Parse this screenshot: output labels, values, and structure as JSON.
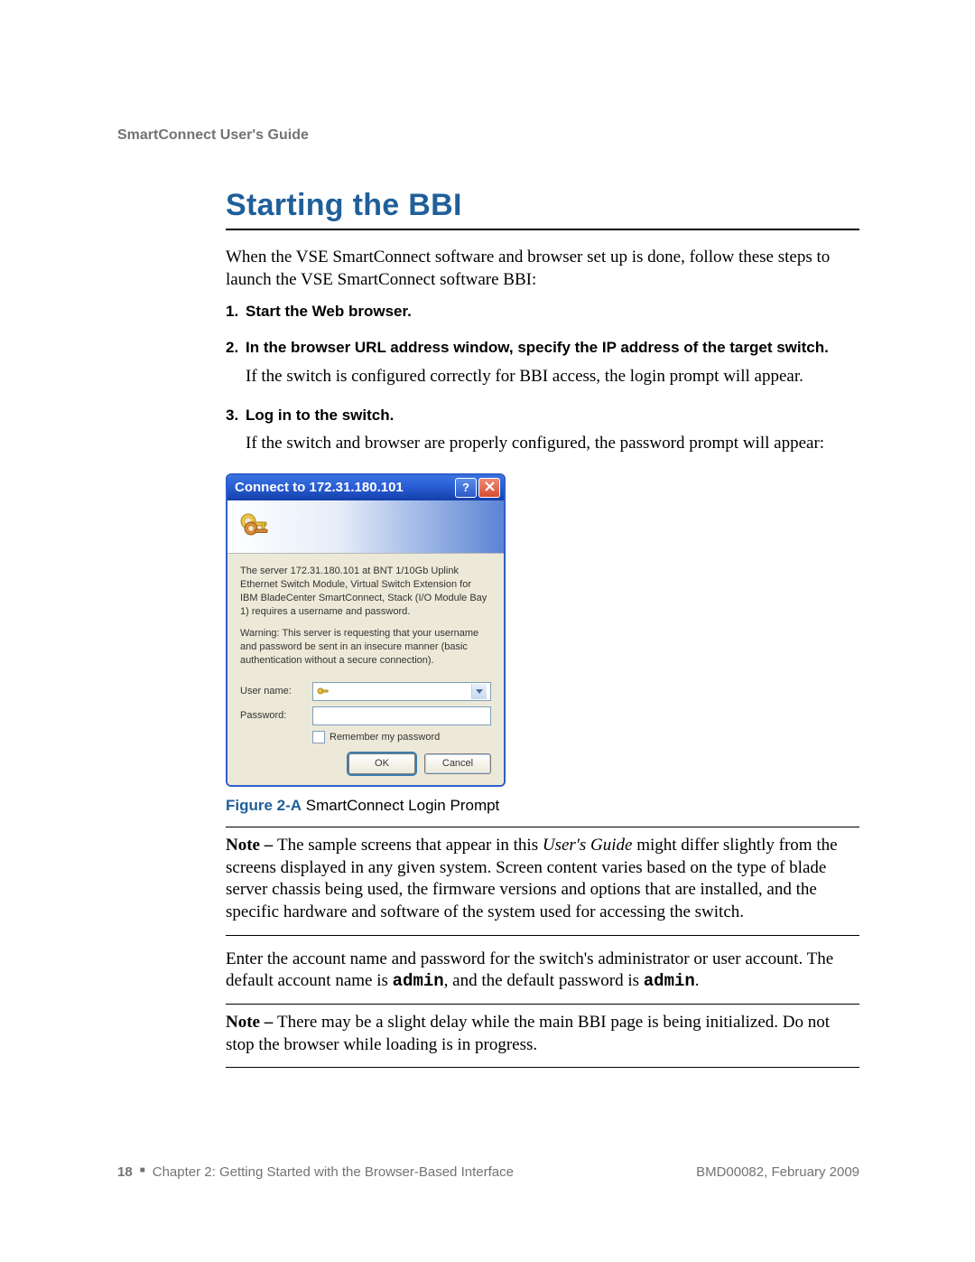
{
  "runningHeader": "SmartConnect User's Guide",
  "sectionTitle": "Starting the BBI",
  "intro": "When the VSE SmartConnect software and browser set up is done, follow these steps to launch the VSE SmartConnect software BBI:",
  "steps": [
    {
      "num": "1.",
      "title": "Start the Web browser."
    },
    {
      "num": "2.",
      "title": "In the browser URL address window, specify the IP address of the target switch.",
      "text": "If the switch is configured correctly for BBI access, the login prompt will appear."
    },
    {
      "num": "3.",
      "title": "Log in to the switch.",
      "text": "If the switch and browser are properly configured, the password prompt will appear:"
    }
  ],
  "dialog": {
    "title": "Connect to 172.31.180.101",
    "helpGlyph": "?",
    "closeGlyphSr": "Close",
    "server_text": "The server 172.31.180.101 at BNT 1/10Gb Uplink Ethernet Switch Module, Virtual Switch Extension for IBM BladeCenter SmartConnect, Stack (I/O Module Bay 1) requires a username and password.",
    "warning_text": "Warning: This server is requesting that your username and password be sent in an insecure manner (basic authentication without a secure connection).",
    "user_label": "User name:",
    "pass_label": "Password:",
    "remember_label": "Remember my password",
    "ok_label": "OK",
    "cancel_label": "Cancel"
  },
  "figure": {
    "label": "Figure 2-A",
    "text": "  SmartConnect Login Prompt"
  },
  "note1_prefix": "Note – ",
  "note1_part1": "The sample screens that appear in this ",
  "note1_italic": "User's Guide",
  "note1_part2": " might differ slightly from the screens displayed in any given system. Screen content varies based on the type of blade server chassis being used, the firmware versions and options that are installed, and the specific hardware and software of the system used for accessing the switch.",
  "account_line_part1": "Enter the account name and password for the switch's administrator or user account. The default account name is ",
  "account_admin1": "admin",
  "account_line_part2": ", and the default password is ",
  "account_admin2": "admin",
  "account_line_part3": ".",
  "note2_prefix": "Note – ",
  "note2_text": "There may be a slight delay while the main BBI page is being initialized. Do not stop the browser while loading is in progress.",
  "footer": {
    "page": "18",
    "chapter": "Chapter 2: Getting Started with the Browser-Based Interface",
    "doc": "BMD00082, February 2009"
  }
}
